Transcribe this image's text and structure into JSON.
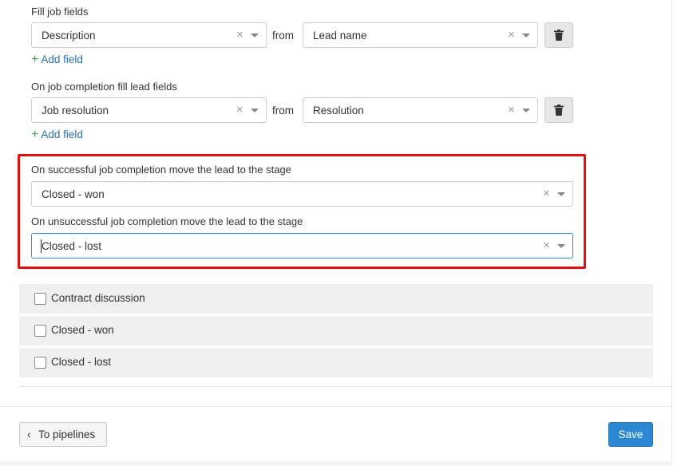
{
  "job_fields": {
    "title": "Fill job fields",
    "field": "Description",
    "from": "from",
    "source": "Lead name",
    "add_field": "Add field",
    "clear_icon": "×",
    "plus_icon": "+"
  },
  "lead_fields": {
    "title": "On job completion fill lead fields",
    "field": "Job resolution",
    "from": "from",
    "source": "Resolution",
    "add_field": "Add field"
  },
  "stages": {
    "success_label": "On successful job completion move the lead to the stage",
    "success_value": "Closed - won",
    "fail_label": "On unsuccessful job completion move the lead to the stage",
    "fail_value": "Closed - lost",
    "highlight_color": "#e01010"
  },
  "stage_list": [
    {
      "label": "Contract discussion",
      "checked": false
    },
    {
      "label": "Closed - won",
      "checked": false
    },
    {
      "label": "Closed - lost",
      "checked": false
    }
  ],
  "footer": {
    "back_label": "To pipelines",
    "back_chevron": "‹",
    "save_label": "Save",
    "save_color": "#2c88d2"
  }
}
